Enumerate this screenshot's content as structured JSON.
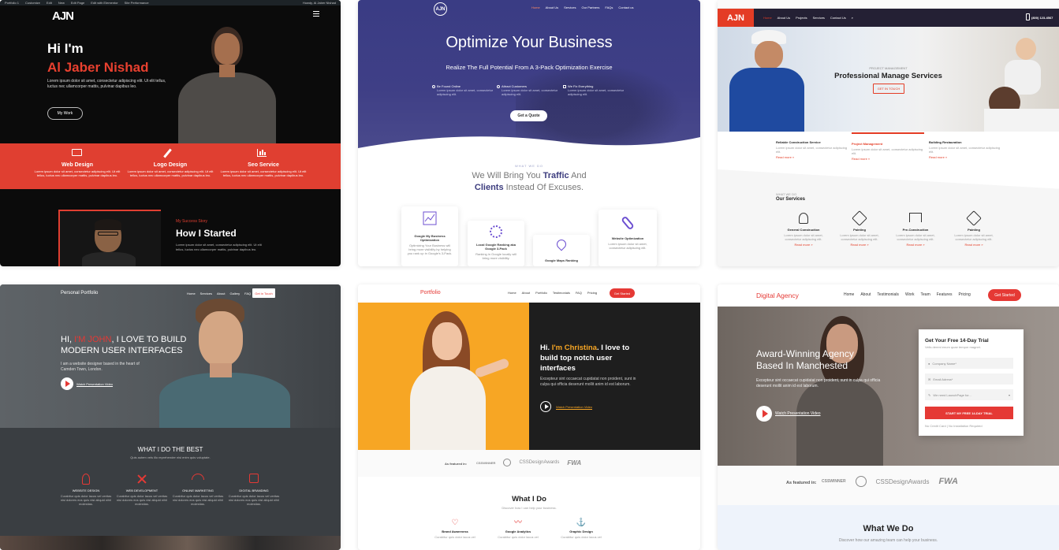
{
  "portfolio1": {
    "topbar": [
      "Portfolio 1",
      "Customize",
      "Edit",
      "New",
      "Edit Page",
      "Edit with Elementor",
      "Site Performance",
      "Howdy, Al Jaber Nishad"
    ],
    "logo": "AJN",
    "hi": "Hi I'm",
    "name": "Al Jaber Nishad",
    "intro": "Lorem ipsum dolor sit amet, consectetur adipiscing elit. Ut elit tellus, luctus nec ullamcorper mattis, pulvinar dapibus leo.",
    "cta": "My Work",
    "services": [
      {
        "title": "Web Design",
        "text": "Lorem ipsum dolor sit amet, consectetur adipiscing elit. Ut elit tellus, luctus nec ullamcorper mattis, pulvinar dapibus leo."
      },
      {
        "title": "Logo Design",
        "text": "Lorem ipsum dolor sit amet, consectetur adipiscing elit. Ut elit tellus, luctus nec ullamcorper mattis, pulvinar dapibus leo."
      },
      {
        "title": "Seo Service",
        "text": "Lorem ipsum dolor sit amet, consectetur adipiscing elit. Ut elit tellus, luctus nec ullamcorper mattis, pulvinar dapibus leo."
      }
    ],
    "story_label": "My Success Story",
    "story_title": "How I Started",
    "story_text": "Lorem ipsum dolor sit amet, consectetur adipiscing elit. Ut elit tellus, luctus nec ullamcorper mattis, pulvinar dapibus leo."
  },
  "business": {
    "logo": "AJN",
    "nav": [
      "Home",
      "About Us",
      "Services",
      "Our Partners",
      "FAQs",
      "Contact us"
    ],
    "title": "Optimize Your Business",
    "subtitle": "Realize The Full Potential From A 3-Pack Optimization Exercise",
    "features": [
      {
        "title": "Be Found Online",
        "text": "Lorem ipsum dolor sit amet, consectetur adipiscing elit."
      },
      {
        "title": "Attract Customers",
        "text": "Lorem ipsum dolor sit amet, consectetur adipiscing elit."
      },
      {
        "title": "We Fix Everything",
        "text": "Lorem ipsum dolor sit amet, consectetur adipiscing elit."
      }
    ],
    "cta": "Get a Quote",
    "what_we_do": "What We Do",
    "tagline_1": "We Will Bring You",
    "tagline_traffic": "Traffic",
    "tagline_and": "And",
    "tagline_clients": "Clients",
    "tagline_2": "Instead Of Excuses.",
    "cards": [
      {
        "title": "Google My Business Optimization",
        "text": "Optimizing Your Business will bring more visibility by helping you rank up in Google's 3-Pack."
      },
      {
        "title": "Local Google Ranking aka Google 3-Pack",
        "text": "Ranking in Google locally will bring more visibility."
      },
      {
        "title": "Google Maps Ranking",
        "text": ""
      },
      {
        "title": "Website Optimization",
        "text": "Lorem ipsum dolor sit amet, consectetur adipiscing elit."
      }
    ]
  },
  "construction": {
    "logo": "AJN",
    "nav": [
      "Home",
      "About Us",
      "Projects",
      "Services",
      "Contact Us"
    ],
    "phone": "(800) 123-4567",
    "label": "PROJECT MANAGEMENT",
    "title": "Professional Manage Services",
    "cta": "GET IN TOUCH",
    "tabs": [
      {
        "title": "Reliable Construction Service",
        "text": "Lorem ipsum dolor sit amet, consectetur adipiscing elit.",
        "more": "Read more »"
      },
      {
        "title": "Project Management",
        "text": "Lorem ipsum dolor sit amet, consectetur adipiscing elit.",
        "more": "Read more »"
      },
      {
        "title": "Building Restauration",
        "text": "Lorem ipsum dolor sit amet, consectetur adipiscing elit.",
        "more": "Read more »"
      }
    ],
    "what_we_do": "WHAT WE DO",
    "our_services": "Our Services",
    "services": [
      {
        "title": "General Construction",
        "text": "Lorem ipsum dolor sit amet, consectetur adipiscing elit.",
        "more": "Read more »"
      },
      {
        "title": "Painting",
        "text": "Lorem ipsum dolor sit amet, consectetur adipiscing elit.",
        "more": "Read more »"
      },
      {
        "title": "Pre-Construction",
        "text": "Lorem ipsum dolor sit amet, consectetur adipiscing elit.",
        "more": "Read more »"
      },
      {
        "title": "Painting",
        "text": "Lorem ipsum dolor sit amet, consectetur adipiscing elit.",
        "more": "Read more »"
      }
    ]
  },
  "personal": {
    "brand": "Personal Portfolio",
    "nav": [
      "Home",
      "Services",
      "About",
      "Gallery",
      "FAQ"
    ],
    "nav_cta": "Get in Touch",
    "headline_1": "HI,",
    "headline_name": "I'M JOHN",
    "headline_2": ", I LOVE TO BUILD",
    "headline_3": "MODERN USER INTERFACES",
    "intro": "I am a website designer based in the heart of Camden Town, London.",
    "video": "Watch Presentation Video",
    "section_title": "WHAT I DO THE BEST",
    "section_sub": "Quis autem vels illo reprehender nisi enim quis voluptate.",
    "services": [
      {
        "title": "WEBSITE DESIGN",
        "text": "Curabitur quis dolor lacus vel veritas nisi dolores eos quis nisi aliquid nihil molestias."
      },
      {
        "title": "WEB DEVELOPMENT",
        "text": "Curabitur quis dolor lacus vel veritas nisi dolores eos quis nisi aliquid nihil molestias."
      },
      {
        "title": "ONLINE MARKETING",
        "text": "Curabitur quis dolor lacus vel veritas nisi dolores eos quis nisi aliquid nihil molestias."
      },
      {
        "title": "DIGITAL BRANDING",
        "text": "Curabitur quis dolor lacus vel veritas nisi dolores eos quis nisi aliquid nihil molestias."
      }
    ]
  },
  "christina": {
    "brand": "Portfolio",
    "nav": [
      "Home",
      "About",
      "Portfolio",
      "Testimonials",
      "FAQ",
      "Pricing"
    ],
    "nav_cta": "Get Started",
    "hi": "Hi.",
    "name": "I'm Christina",
    "line_1": ". I love to",
    "line_2": "build top notch user",
    "line_3": "interfaces",
    "text": "Excepteur sint occaecat cupidatat non proident, sunt in culpa qui officia deserunt mollit anim id est laborum.",
    "video": "Watch Presentation Video",
    "featured": "As featured in:",
    "logos": [
      "CSSWINNER",
      "",
      "CSSDesignAwards",
      "FWA"
    ],
    "what_i_do": "What I Do",
    "what_i_do_sub": "Discover how I can help your business.",
    "services": [
      {
        "title": "Brand Awareness",
        "text": "Curabitur quis dolor lacus vel"
      },
      {
        "title": "Google Analytics",
        "text": "Curabitur quis dolor lacus vel"
      },
      {
        "title": "Graphic Design",
        "text": "Curabitur quis dolor lacus vel"
      }
    ]
  },
  "agency": {
    "brand": "Digital Agency",
    "nav": [
      "Home",
      "About",
      "Testimonials",
      "Work",
      "Team",
      "Features",
      "Pricing"
    ],
    "nav_cta": "Get Started",
    "title_1": "Award-Winning Agency",
    "title_2": "Based In Manchested",
    "text": "Excepteur sint occaecat cupidatat non proident, sunt in culpa qui officia deserunt mollit anim id est laborum.",
    "video": "Watch Presentation Video",
    "form": {
      "title": "Get Your Free 14-Day Trial",
      "sub": "Velis dereni enum quae tempor magnet.",
      "company": "Company Name*",
      "email": "Email Adress*",
      "select": "We need LaunchPage for...",
      "submit": "START MY FREE 14-DAY TRIAL",
      "note": "No Credit Card | No Installation Required"
    },
    "featured": "As featured in:",
    "logos": [
      "CSSWINNER",
      "",
      "CSSDesignAwards",
      "FWA"
    ],
    "what_we_do": "What We Do",
    "what_we_do_sub": "Discover how our amazing team can help your business."
  }
}
